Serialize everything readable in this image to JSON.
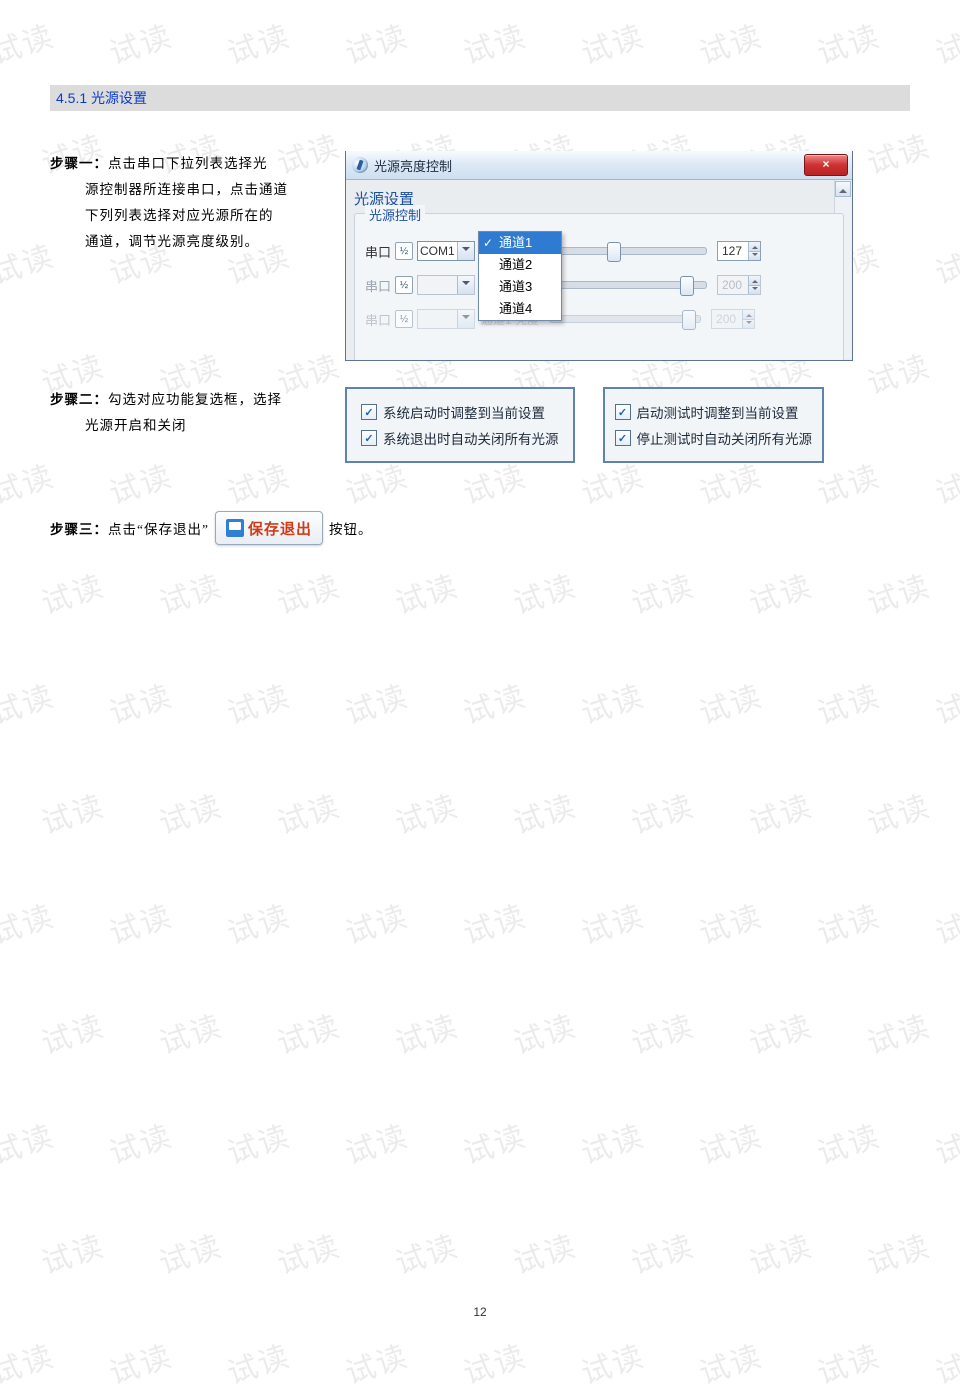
{
  "watermark": "试读",
  "heading": "4.5.1  光源设置",
  "step1": {
    "bold": "步骤一：",
    "rest1": "点击串口下拉列表选择光",
    "line2": "源控制器所连接串口，点击通道",
    "line3": "下列列表选择对应光源所在的",
    "line4": "通道，调节光源亮度级别。"
  },
  "dialog": {
    "title": "光源亮度控制",
    "close": "×",
    "section": "光源设置",
    "group": "光源控制",
    "chuankou": "串口",
    "toggle_glyph": "½",
    "com1": "COM1",
    "dropdown": [
      "通道1",
      "通道2",
      "通道3",
      "通道4"
    ],
    "row1_val": "127",
    "row2_val": "200",
    "row3_val": "200",
    "row3_hint": "通道1 亮度"
  },
  "step2": {
    "bold": "步骤二：",
    "rest1": "勾选对应功能复选框，选择",
    "line2": "光源开启和关闭"
  },
  "checks_left": [
    "系统启动时调整到当前设置",
    "系统退出时自动关闭所有光源"
  ],
  "checks_right": [
    "启动测试时调整到当前设置",
    "停止测试时自动关闭所有光源"
  ],
  "step3": {
    "bold": "步骤三：",
    "mid": "点击“保存退出”",
    "btn": "保存退出",
    "after": "按钮。"
  },
  "page_number": "12"
}
